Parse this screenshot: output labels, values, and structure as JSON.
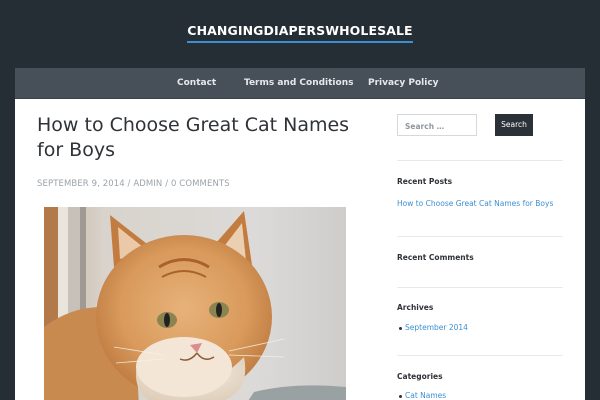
{
  "site": {
    "title": "CHANGINGDIAPERSWHOLESALE"
  },
  "nav": {
    "items": [
      {
        "label": "Contact"
      },
      {
        "label": "Terms and Conditions"
      },
      {
        "label": "Privacy Policy"
      }
    ]
  },
  "post": {
    "title": "How to Choose Great Cat Names for Boys",
    "date": "SEPTEMBER 9, 2014",
    "author": "ADMIN",
    "comments": "0 COMMENTS",
    "separator": " / "
  },
  "sidebar": {
    "search": {
      "placeholder": "Search …",
      "button": "Search"
    },
    "recent_posts": {
      "title": "Recent Posts",
      "items": [
        "How to Choose Great Cat Names for Boys"
      ]
    },
    "recent_comments": {
      "title": "Recent Comments"
    },
    "archives": {
      "title": "Archives",
      "items": [
        "September 2014"
      ]
    },
    "categories": {
      "title": "Categories",
      "items": [
        "Cat Names"
      ]
    }
  },
  "colors": {
    "background": "#252d35",
    "nav": "#475059",
    "accent": "#3d8fd1",
    "content": "#ffffff"
  }
}
